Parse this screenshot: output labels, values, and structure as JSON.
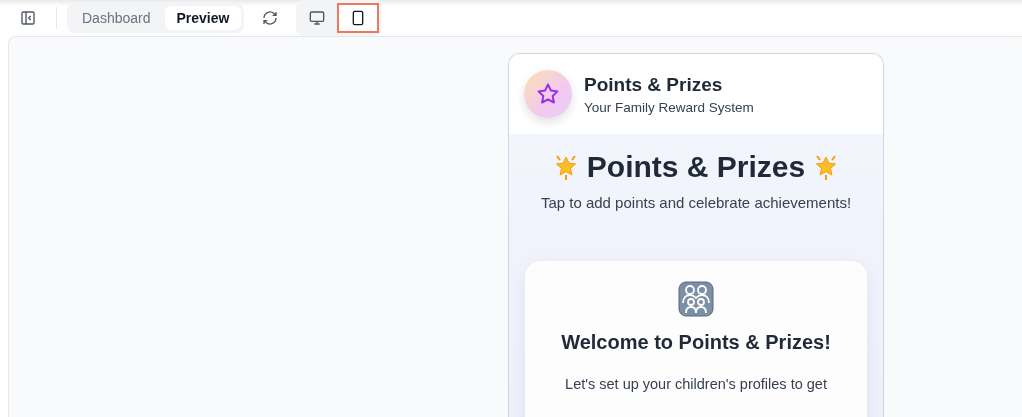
{
  "toolbar": {
    "tabs": [
      {
        "label": "Dashboard",
        "selected": false
      },
      {
        "label": "Preview",
        "selected": true
      }
    ],
    "devices": [
      {
        "kind": "desktop",
        "selected": false
      },
      {
        "kind": "mobile",
        "selected": true
      }
    ]
  },
  "app": {
    "name": "Points & Prizes",
    "tagline": "Your Family Reward System"
  },
  "hero": {
    "title": "Points & Prizes",
    "subtitle": "Tap to add points and celebrate achievements!"
  },
  "welcome": {
    "title": "Welcome to Points & Prizes!",
    "text": "Let's set up your children's profiles to get"
  }
}
